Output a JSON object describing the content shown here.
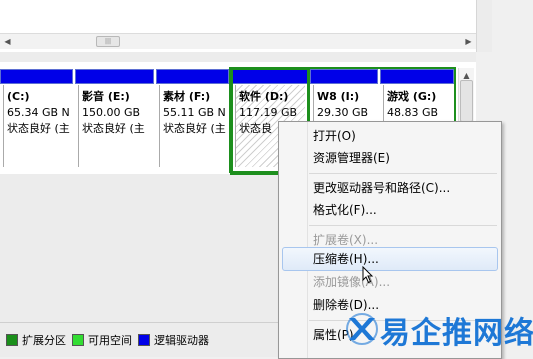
{
  "volumes": [
    {
      "name": "(C:)",
      "size": "65.34 GB N",
      "status": "状态良好 (主"
    },
    {
      "name": "影音  (E:)",
      "size": "150.00 GB",
      "status": "状态良好 (主"
    },
    {
      "name": "素材  (F:)",
      "size": "55.11 GB N",
      "status": "状态良好 (主"
    },
    {
      "name": "软件  (D:)",
      "size": "117.19 GB",
      "status": "状态良"
    },
    {
      "name": "W8  (I:)",
      "size": "29.30 GB",
      "status": ""
    },
    {
      "name": "游戏  (G:)",
      "size": "48.83 GB",
      "status": ""
    }
  ],
  "legend": [
    {
      "label": "扩展分区",
      "color": "#1a8f1a"
    },
    {
      "label": "可用空间",
      "color": "#33dd33"
    },
    {
      "label": "逻辑驱动器",
      "color": "#0000e8"
    }
  ],
  "context_menu": {
    "items": [
      {
        "label": "打开(O)",
        "disabled": false
      },
      {
        "label": "资源管理器(E)",
        "disabled": false
      },
      {
        "label": "更改驱动器号和路径(C)...",
        "disabled": false
      },
      {
        "label": "格式化(F)...",
        "disabled": false
      },
      {
        "label": "扩展卷(X)...",
        "disabled": true
      },
      {
        "label": "压缩卷(H)...",
        "disabled": false,
        "hovered": true
      },
      {
        "label": "添加镜像(A)...",
        "disabled": true
      },
      {
        "label": "删除卷(D)...",
        "disabled": false
      },
      {
        "label": "属性(P)",
        "disabled": false
      }
    ]
  },
  "watermark": {
    "text": "易企推网络"
  },
  "icons": {
    "scroll_left": "arrow-left-icon",
    "scroll_right": "arrow-right-icon",
    "scroll_up": "arrow-up-icon",
    "cursor": "mouse-pointer-icon",
    "watermark_logo": "x-logo-icon"
  }
}
